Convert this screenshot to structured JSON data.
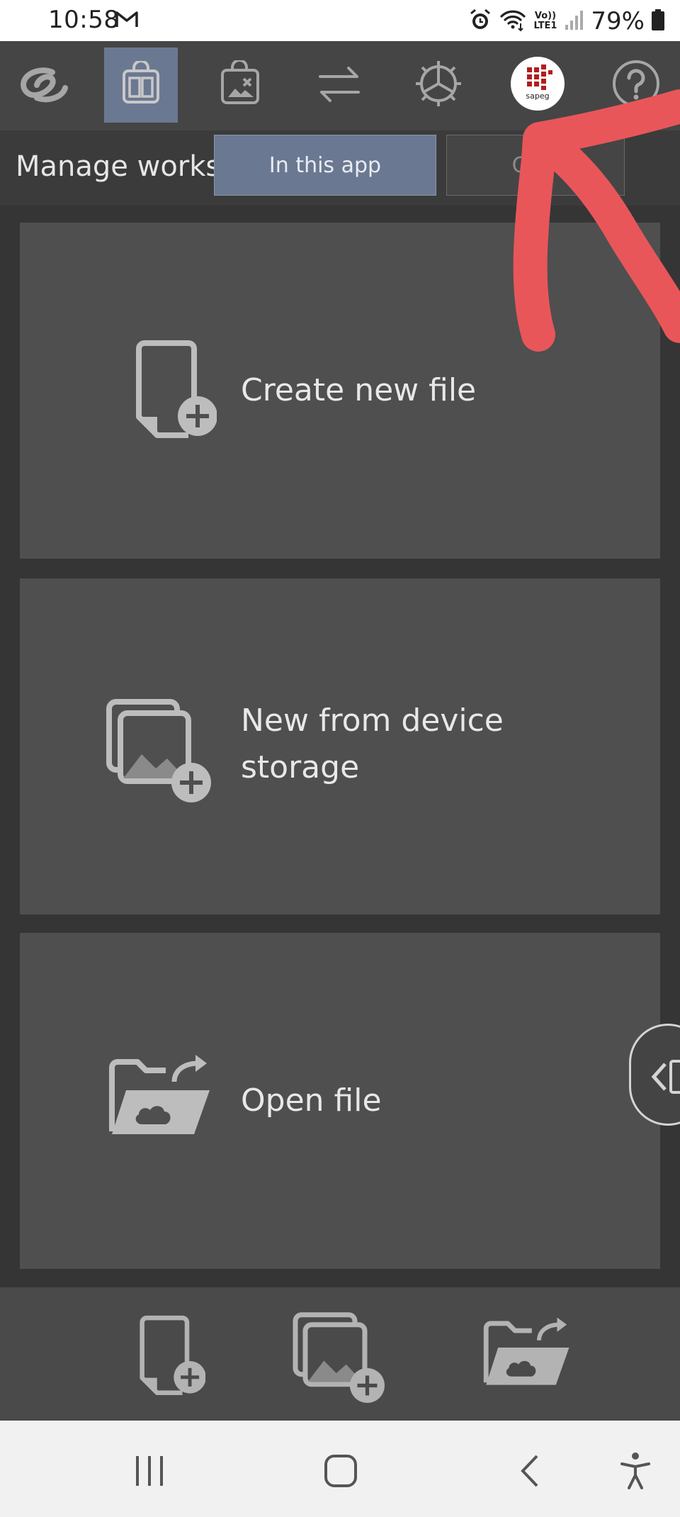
{
  "status_bar": {
    "time": "10:58",
    "network_label": "Vo))\nLTE1",
    "battery": "79%",
    "icons": [
      "gmail-icon",
      "alarm-icon",
      "wifi-icon",
      "signal-icon",
      "battery-icon"
    ]
  },
  "toolbar": {
    "items": [
      {
        "icon": "clip-studio-logo-icon",
        "active": false
      },
      {
        "icon": "manage-works-icon",
        "active": true
      },
      {
        "icon": "assets-icon",
        "active": false
      },
      {
        "icon": "transfer-icon",
        "active": false
      },
      {
        "icon": "settings-icon",
        "active": false
      },
      {
        "icon": "sapeg-avatar-icon",
        "active": false
      },
      {
        "icon": "help-icon",
        "active": false
      }
    ],
    "avatar_text": "sapeg"
  },
  "tabs": {
    "title": "Manage works",
    "in_app_label": "In this app",
    "cloud_label": "Clou"
  },
  "cards": [
    {
      "label": "Create new file",
      "icon": "new-file-icon"
    },
    {
      "label_line1": "New from device",
      "label_line2": "storage",
      "icon": "device-images-icon"
    },
    {
      "label": "Open file",
      "icon": "open-folder-icon"
    }
  ],
  "bottom_bar": {
    "items": [
      "new-file-icon",
      "device-images-icon",
      "open-folder-icon"
    ]
  },
  "nav_bar": {
    "items": [
      "recents-icon",
      "home-icon",
      "back-icon",
      "accessibility-icon"
    ]
  },
  "colors": {
    "accent": "#6b7891",
    "annotation": "#e8565a"
  }
}
